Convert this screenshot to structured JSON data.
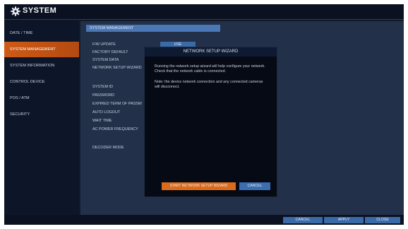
{
  "header": {
    "title": "SYSTEM",
    "icon": "gear-icon"
  },
  "sidebar": {
    "items": [
      {
        "label": "DATE / TIME",
        "active": false
      },
      {
        "label": "SYSTEM MANAGEMENT",
        "active": true
      },
      {
        "label": "SYSTEM INFORMATION",
        "active": false
      },
      {
        "label": "CONTROL DEVICE",
        "active": false
      },
      {
        "label": "POS / ATM",
        "active": false
      },
      {
        "label": "SECURITY",
        "active": false
      }
    ]
  },
  "main": {
    "section_title": "SYSTEM MANAGEMENT",
    "rows": [
      "F/W UPDATE",
      "FACTORY DEFAULT",
      "SYSTEM DATA",
      "NETWORK SETUP WIZARD",
      "SYSTEM ID",
      "PASSWORD",
      "EXPIRED TERM OF PASSW",
      "AUTO LOGOUT",
      "WAIT TIME",
      "AC POWER FREQUENCY",
      "DECODER MODE"
    ],
    "use_button": "USE"
  },
  "modal": {
    "title": "NETWORK SETUP WIZARD",
    "text1": "Running the network setup wizard will help configure your network. Check that the network cable is connected.",
    "text2": "Note: the device network connection and any connected cameras will disconnect.",
    "start_label": "START NETWORK SETUP WIZARD",
    "cancel_label": "CANCEL"
  },
  "footer": {
    "cancel": "CANCEL",
    "apply": "APPLY",
    "close": "CLOSE"
  },
  "colors": {
    "accent": "#d96a1e",
    "button": "#3b6aa8",
    "background": "#121a2a"
  }
}
